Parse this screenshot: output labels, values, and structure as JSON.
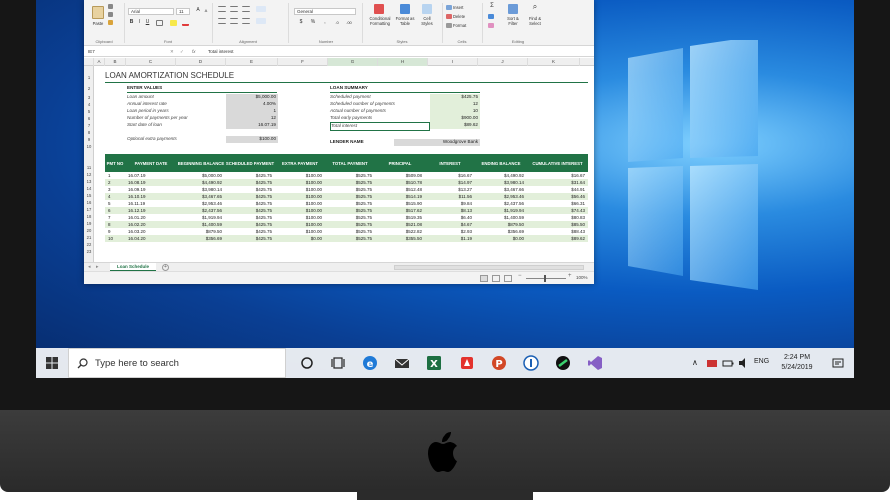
{
  "ribbon": {
    "font_name": "Arial",
    "font_size": "11",
    "number_format": "General",
    "group_clipboard": "Clipboard",
    "group_font": "Font",
    "group_alignment": "Alignment",
    "group_number": "Number",
    "group_styles": "Styles",
    "group_cells": "Cells",
    "group_editing": "Editing",
    "paste": "Paste",
    "conditional_formatting": "Conditional\nFormatting",
    "format_as_table": "Format as\nTable",
    "cell_styles": "Cell\nStyles",
    "insert": "Insert",
    "delete": "Delete",
    "format": "Format",
    "sort_filter": "Sort &\nFilter",
    "find_select": "Find &\nSelect"
  },
  "formula_bar": {
    "name_box": "IE7",
    "fx": "fx",
    "content": "Total interest"
  },
  "columns": [
    "A",
    "B",
    "C",
    "D",
    "E",
    "F",
    "G",
    "H",
    "I",
    "J",
    "K"
  ],
  "rows": [
    "1",
    "2",
    "3",
    "4",
    "5",
    "6",
    "7",
    "8",
    "9",
    "10",
    "11",
    "12",
    "13",
    "14",
    "15",
    "16",
    "17",
    "18",
    "19",
    "20",
    "21",
    "22",
    "23"
  ],
  "sheet": {
    "title": "LOAN AMORTIZATION SCHEDULE",
    "enter_values": {
      "header": "ENTER VALUES",
      "items": [
        {
          "label": "Loan amount",
          "value": "$5,000.00"
        },
        {
          "label": "Annual interest rate",
          "value": "4.00%"
        },
        {
          "label": "Loan period in years",
          "value": "1"
        },
        {
          "label": "Number of payments per year",
          "value": "12"
        },
        {
          "label": "Start date of loan",
          "value": "16.07.19"
        }
      ],
      "optional_label": "Optional extra payments",
      "optional_value": "$100.00"
    },
    "loan_summary": {
      "header": "LOAN SUMMARY",
      "items": [
        {
          "label": "Scheduled payment",
          "value": "$425.75"
        },
        {
          "label": "Scheduled number of payments",
          "value": "12"
        },
        {
          "label": "Actual number of payments",
          "value": "10"
        },
        {
          "label": "Total early payments",
          "value": "$900.00"
        },
        {
          "label": "Total interest",
          "value": "$89.62"
        }
      ],
      "lender_label": "LENDER NAME",
      "lender_value": "Woodgrove Bank"
    },
    "table_headers": [
      "PMT NO",
      "PAYMENT DATE",
      "BEGINNING BALANCE",
      "SCHEDULED PAYMENT",
      "EXTRA PAYMENT",
      "TOTAL PAYMENT",
      "PRINCIPAL",
      "INTEREST",
      "ENDING BALANCE",
      "CUMULATIVE INTEREST"
    ],
    "table_rows": [
      [
        "1",
        "16.07.19",
        "$5,000.00",
        "$425.75",
        "$100.00",
        "$525.75",
        "$509.08",
        "$16.67",
        "$4,490.92",
        "$16.67"
      ],
      [
        "2",
        "16.08.19",
        "$4,490.92",
        "$425.75",
        "$100.00",
        "$525.75",
        "$510.78",
        "$14.97",
        "$3,980.14",
        "$31.64"
      ],
      [
        "3",
        "16.09.19",
        "$3,980.14",
        "$425.75",
        "$100.00",
        "$525.75",
        "$512.48",
        "$13.27",
        "$3,467.66",
        "$44.91"
      ],
      [
        "4",
        "16.10.19",
        "$3,467.65",
        "$425.75",
        "$100.00",
        "$525.75",
        "$514.19",
        "$11.56",
        "$2,953.46",
        "$56.46"
      ],
      [
        "5",
        "16.11.19",
        "$2,953.46",
        "$425.75",
        "$100.00",
        "$525.75",
        "$515.90",
        "$9.84",
        "$2,437.56",
        "$66.31"
      ],
      [
        "6",
        "16.12.19",
        "$2,437.56",
        "$425.75",
        "$100.00",
        "$525.75",
        "$517.62",
        "$8.13",
        "$1,919.94",
        "$74.43"
      ],
      [
        "7",
        "16.01.20",
        "$1,919.94",
        "$425.75",
        "$100.00",
        "$525.75",
        "$519.35",
        "$6.40",
        "$1,400.59",
        "$80.83"
      ],
      [
        "8",
        "16.02.20",
        "$1,400.59",
        "$425.75",
        "$100.00",
        "$525.75",
        "$521.08",
        "$4.67",
        "$879.50",
        "$85.50"
      ],
      [
        "9",
        "16.03.20",
        "$879.50",
        "$425.75",
        "$100.00",
        "$525.75",
        "$522.82",
        "$2.93",
        "$356.69",
        "$88.43"
      ],
      [
        "10",
        "16.04.20",
        "$356.69",
        "$425.75",
        "$0.00",
        "$525.75",
        "$355.50",
        "$1.19",
        "$0.00",
        "$89.62"
      ]
    ]
  },
  "sheet_tab": "Loan Schedule",
  "status": {
    "zoom": "100%"
  },
  "taskbar": {
    "search_placeholder": "Type here to search",
    "language": "ENG",
    "time": "2:24 PM",
    "date": "5/24/2019"
  },
  "colors": {
    "excel_green": "#217346",
    "light_green": "#e2efda",
    "desktop_blue": "#0a5bc2"
  }
}
